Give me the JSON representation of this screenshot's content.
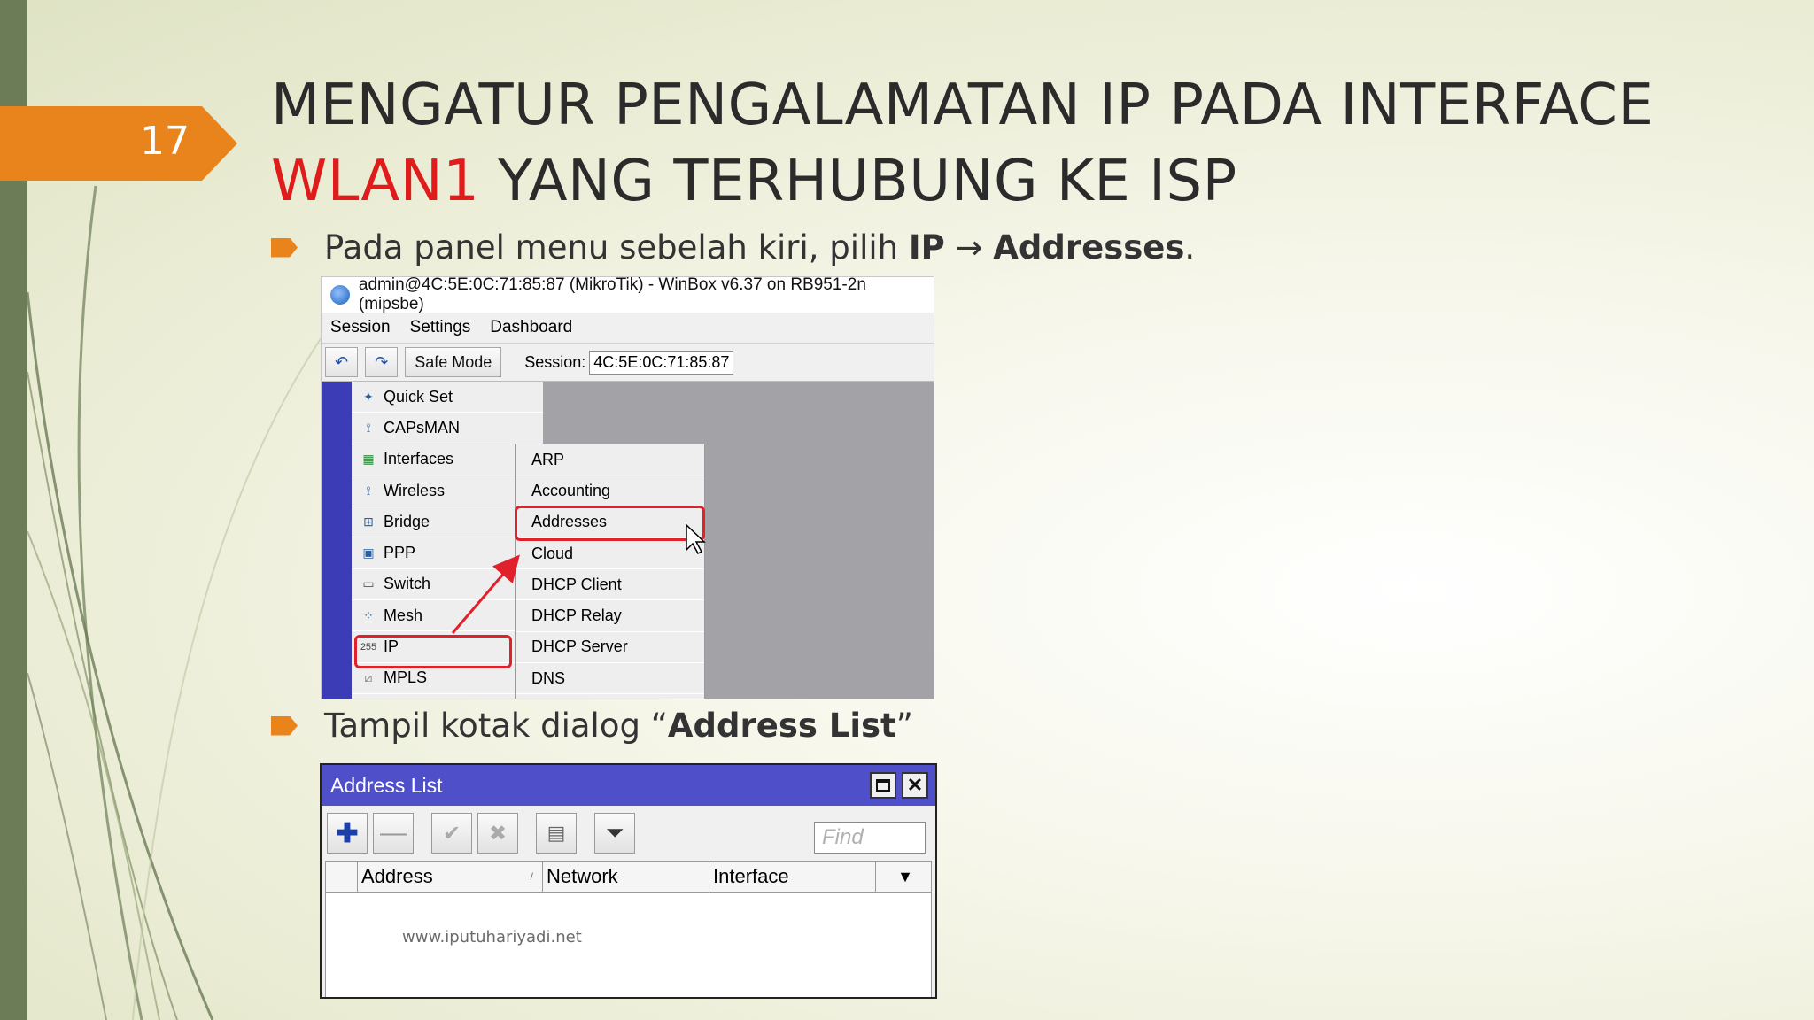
{
  "slide": {
    "page_number": "17",
    "title_line1": "MENGATUR PENGALAMATAN IP PADA INTERFACE",
    "title_highlight": "WLAN1",
    "title_line2_rest": " YANG TERHUBUNG KE ISP",
    "bullet1_prefix": "Pada panel menu sebelah kiri, pilih ",
    "bullet1_bold1": "IP",
    "bullet1_arrow": " → ",
    "bullet1_bold2": "Addresses",
    "bullet1_suffix": ".",
    "bullet2_prefix": "Tampil kotak dialog “",
    "bullet2_bold": "Address List",
    "bullet2_suffix": "”",
    "colors": {
      "accent": "#e8841b",
      "highlight": "#e01b1b",
      "strip": "#6b7c56"
    }
  },
  "winbox": {
    "title": "admin@4C:5E:0C:71:85:87 (MikroTik) - WinBox v6.37 on RB951-2n (mipsbe)",
    "menu": [
      "Session",
      "Settings",
      "Dashboard"
    ],
    "toolbar": {
      "safe_mode": "Safe Mode",
      "session_label": "Session:",
      "session_value": "4C:5E:0C:71:85:87"
    },
    "sidebar": [
      {
        "label": "Quick Set",
        "icon": "wand-icon"
      },
      {
        "label": "CAPsMAN",
        "icon": "antenna-icon"
      },
      {
        "label": "Interfaces",
        "icon": "interfaces-icon"
      },
      {
        "label": "Wireless",
        "icon": "antenna-icon"
      },
      {
        "label": "Bridge",
        "icon": "bridge-icon"
      },
      {
        "label": "PPP",
        "icon": "ppp-icon"
      },
      {
        "label": "Switch",
        "icon": "switch-icon"
      },
      {
        "label": "Mesh",
        "icon": "mesh-icon"
      },
      {
        "label": "IP",
        "icon": "ip-icon"
      },
      {
        "label": "MPLS",
        "icon": "mpls-icon"
      }
    ],
    "submenu": [
      "ARP",
      "Accounting",
      "Addresses",
      "Cloud",
      "DHCP Client",
      "DHCP Relay",
      "DHCP Server",
      "DNS"
    ]
  },
  "address_list": {
    "title": "Address List",
    "find_placeholder": "Find",
    "columns": [
      "Address",
      "Network",
      "Interface"
    ],
    "watermark": "www.iputuhariyadi.net"
  }
}
